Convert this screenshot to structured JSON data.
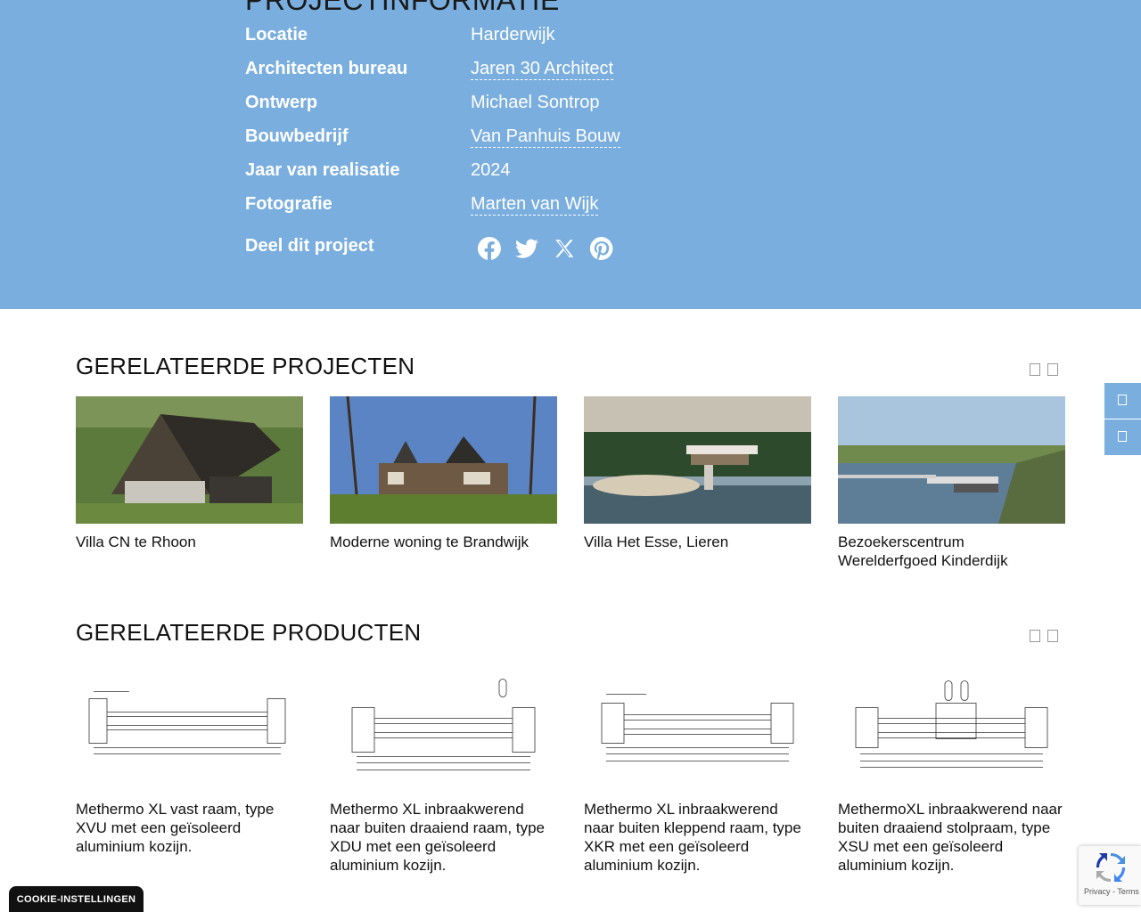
{
  "hero": {
    "title": "PROJECTINFORMATIE",
    "rows": [
      {
        "label": "Locatie",
        "value": "Harderwijk"
      },
      {
        "label": "Architecten bureau",
        "value": "Jaren 30 Architect"
      },
      {
        "label": "Ontwerp",
        "value": "Michael Sontrop"
      },
      {
        "label": "Bouwbedrijf",
        "value": "Van Panhuis Bouw"
      },
      {
        "label": "Jaar van realisatie",
        "value": "2024"
      },
      {
        "label": "Fotografie",
        "value": "Marten van Wijk"
      }
    ],
    "share_label": "Deel dit project",
    "share_icons": [
      "facebook-icon",
      "twitter-icon",
      "x-icon",
      "pinterest-icon"
    ]
  },
  "projects": {
    "title": "GERELATEERDE PROJECTEN",
    "items": [
      {
        "caption": "Villa CN te Rhoon"
      },
      {
        "caption": "Moderne woning te Brandwijk"
      },
      {
        "caption": "Villa Het Esse, Lieren"
      },
      {
        "caption": "Bezoekerscentrum Werelderfgoed Kinderdijk"
      }
    ]
  },
  "products": {
    "title": "GERELATEERDE PRODUCTEN",
    "items": [
      {
        "caption": "Methermo XL vast raam, type XVU met een geïsoleerd aluminium kozijn."
      },
      {
        "caption": "Methermo XL inbraakwerend naar buiten draaiend raam, type XDU met een geïsoleerd aluminium kozijn."
      },
      {
        "caption": "Methermo XL inbraakwerend naar buiten kleppend raam, type XKR met een geïsoleerd aluminium kozijn."
      },
      {
        "caption": "MethermoXL inbraakwerend naar buiten draaiend stolpraam, type XSU met een geïsoleerd aluminium kozijn."
      }
    ]
  },
  "cookie_button": "COOKIE-INSTELLINGEN",
  "recaptcha": {
    "privacy": "Privacy",
    "sep": " - ",
    "terms": "Terms"
  },
  "colors": {
    "hero_bg": "#7aaede",
    "text": "#111111",
    "cookie_bg": "#111111"
  }
}
